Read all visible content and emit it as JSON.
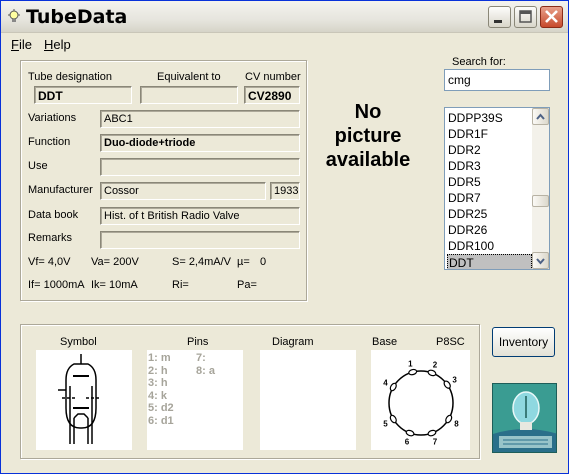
{
  "window": {
    "title": "TubeData"
  },
  "menu": {
    "items": [
      {
        "label": "File",
        "accel": "F",
        "rest": "ile"
      },
      {
        "label": "Help",
        "accel": "H",
        "rest": "elp"
      }
    ]
  },
  "details": {
    "tube_designation_label": "Tube designation",
    "tube_designation": "DDT",
    "equivalent_label": "Equivalent to",
    "equivalent": "",
    "cv_label": "CV number",
    "cv": "CV2890",
    "variations_label": "Variations",
    "variations": "ABC1",
    "function_label": "Function",
    "function": "Duo-diode+triode",
    "use_label": "Use",
    "use": "",
    "manufacturer_label": "Manufacturer",
    "manufacturer": "Cossor",
    "year": "1933",
    "databook_label": "Data book",
    "databook": "Hist. of t British Radio Valve",
    "remarks_label": "Remarks",
    "remarks": "",
    "vf": "Vf= 4,0V",
    "va": "Va= 200V",
    "s": "S= 2,4mA/V",
    "mu": "µ=",
    "mu_value": "0",
    "if": "If= 1000mA",
    "ik": "Ik= 10mA",
    "ri": "Ri=",
    "pa": "Pa="
  },
  "picture": {
    "line1": "No",
    "line2": "picture",
    "line3": "available"
  },
  "search": {
    "label": "Search for:",
    "value": "cmg"
  },
  "tube_list": {
    "items": [
      "DDPP39S",
      "DDR1F",
      "DDR2",
      "DDR3",
      "DDR5",
      "DDR7",
      "DDR25",
      "DDR26",
      "DDR100",
      "DDT"
    ],
    "selected": "DDT"
  },
  "bottom": {
    "symbol_label": "Symbol",
    "pins_label": "Pins",
    "diagram_label": "Diagram",
    "base_label": "Base",
    "base_type": "P8SC",
    "pins_col1": [
      "1: m",
      "2: h",
      "3: h",
      "4: k",
      "5: d2",
      "6: d1"
    ],
    "pins_col2": [
      "7:",
      "8: a"
    ],
    "base_pin_numbers": [
      "1",
      "2",
      "3",
      "4",
      "5",
      "6",
      "7",
      "8"
    ]
  },
  "inventory_button": "Inventory",
  "colors": {
    "title_close": "#c74a2c",
    "list_selected": "#c0c0c0",
    "pin_text": "#a6a49a"
  }
}
